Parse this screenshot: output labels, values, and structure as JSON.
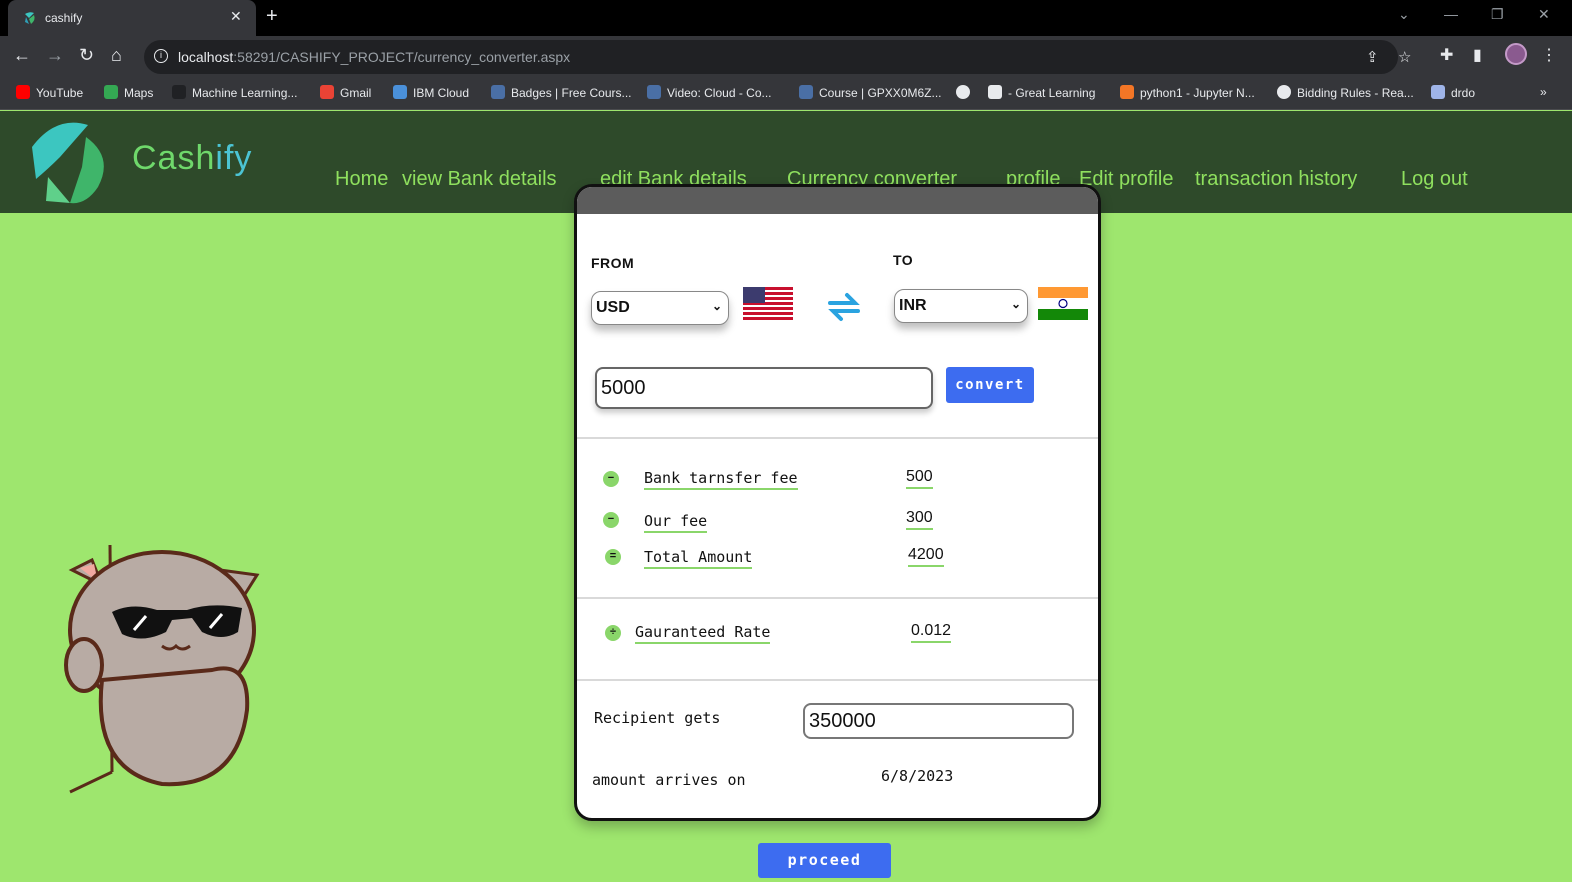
{
  "browser": {
    "tab_title": "cashify",
    "url_host": "localhost",
    "url_rest": ":58291/CASHIFY_PROJECT/currency_converter.aspx",
    "bookmarks": [
      {
        "label": "YouTube",
        "color": "#ff0000"
      },
      {
        "label": "Maps",
        "color": "#34a853"
      },
      {
        "label": "Machine Learning...",
        "color": "#202124"
      },
      {
        "label": "Gmail",
        "color": "#ea4335"
      },
      {
        "label": "IBM Cloud",
        "color": "#4a90d9"
      },
      {
        "label": "Badges | Free Cours...",
        "color": "#4a6fa5"
      },
      {
        "label": "Video: Cloud - Co...",
        "color": "#4a6fa5"
      },
      {
        "label": "Course | GPXX0M6Z...",
        "color": "#4a6fa5"
      },
      {
        "label": "",
        "color": "#e8eaed"
      },
      {
        "label": "- Great Learning",
        "color": "#e8eaed"
      },
      {
        "label": "python1 - Jupyter N...",
        "color": "#f37626"
      },
      {
        "label": "Bidding Rules - Rea...",
        "color": "#e8eaed"
      },
      {
        "label": "drdo",
        "color": "#9fb4e8"
      }
    ]
  },
  "site": {
    "brand_a": "Cash",
    "brand_b": "i",
    "brand_c": "fy",
    "nav": [
      "Home",
      "view Bank details",
      "edit Bank details",
      "Currency converter",
      "profile",
      "Edit profile",
      "transaction history",
      "Log out"
    ]
  },
  "converter": {
    "from_label": "FROM",
    "to_label": "TO",
    "from_currency": "USD",
    "to_currency": "INR",
    "amount": "5000",
    "convert_label": "convert",
    "fees": [
      {
        "sign": "−",
        "label": "Bank tarnsfer fee",
        "value": "500"
      },
      {
        "sign": "−",
        "label": "Our fee",
        "value": "300"
      },
      {
        "sign": "=",
        "label": "Total Amount",
        "value": "4200"
      }
    ],
    "rate": {
      "sign": "÷",
      "label": "Gauranteed Rate",
      "value": "0.012"
    },
    "recipient_label": "Recipient gets",
    "recipient_value": "350000",
    "arrives_label": "amount arrives on",
    "arrives_value": "6/8/2023",
    "proceed_label": "proceed"
  },
  "colors": {
    "page_bg": "#9ee66e",
    "header_bg": "#2e4a2a",
    "nav_text": "#8fe05e",
    "button": "#3d6cf0"
  }
}
